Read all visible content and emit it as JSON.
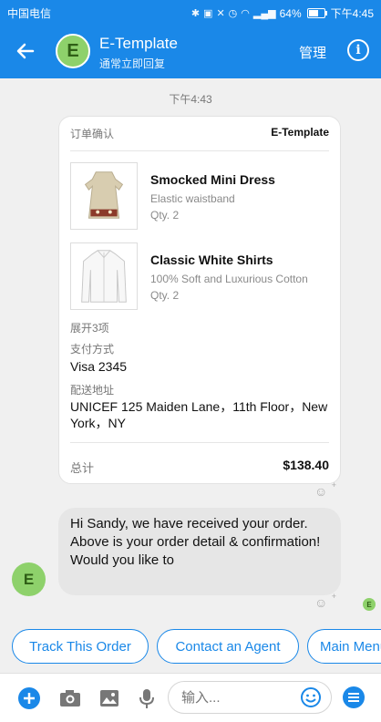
{
  "status_bar": {
    "carrier": "中国电信",
    "battery": "64%",
    "time": "下午4:45",
    "battery_level": 0.64
  },
  "header": {
    "title": "E-Template",
    "subtitle": "通常立即回复",
    "avatar_letter": "E",
    "manage": "管理",
    "info": "i"
  },
  "timestamp": "下午4:43",
  "receipt": {
    "label": "订单确认",
    "brand": "E-Template",
    "items": [
      {
        "name": "Smocked Mini Dress",
        "desc": "Elastic waistband",
        "qty": "Qty. 2"
      },
      {
        "name": "Classic White Shirts",
        "desc": "100% Soft and Luxurious Cotton",
        "qty": "Qty. 2"
      }
    ],
    "expand": "展开3项",
    "payment_label": "支付方式",
    "payment_value": "Visa 2345",
    "address_label": "配送地址",
    "address_value": "UNICEF 125 Maiden Lane，11th Floor，New York，NY",
    "total_label": "总计",
    "total_value": "$138.40"
  },
  "message": {
    "text": "Hi Sandy, we have received your order. Above is your order detail & confirmation!\nWould you like to",
    "avatar_letter": "E"
  },
  "quick_replies": [
    "Track This Order",
    "Contact an Agent",
    "Main Menu"
  ],
  "composer": {
    "placeholder": "输入..."
  },
  "colors": {
    "brand": "#1a88e8",
    "avatar": "#8ed16b"
  }
}
